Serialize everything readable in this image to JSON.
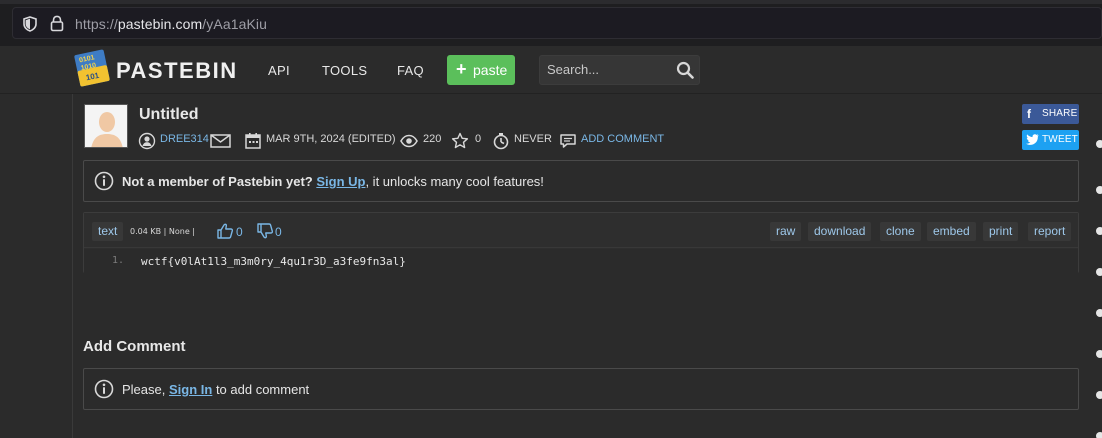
{
  "browser": {
    "url_scheme": "https://",
    "url_host": "pastebin.com",
    "url_path": "/yAa1aKiu"
  },
  "header": {
    "brand": "PASTEBIN",
    "logo_digits": [
      "0101",
      "1010",
      "101"
    ],
    "nav": [
      "API",
      "TOOLS",
      "FAQ"
    ],
    "paste_button": "paste",
    "search_placeholder": "Search..."
  },
  "post": {
    "title": "Untitled",
    "author": "DREE314",
    "date": "MAR 9TH, 2024 (EDITED)",
    "views": "220",
    "stars": "0",
    "expiry": "NEVER",
    "add_comment_link": "ADD COMMENT",
    "share_label": "SHARE",
    "tweet_label": "TWEET"
  },
  "notice": {
    "bold_text": "Not a member of Pastebin yet?",
    "link": "Sign Up",
    "rest": ", it unlocks many cool features!"
  },
  "code": {
    "syntax": "text",
    "info": "0.04 KB | None |",
    "likes": "0",
    "dislikes": "0",
    "actions": [
      "raw",
      "download",
      "clone",
      "embed",
      "print",
      "report"
    ],
    "lines": [
      {
        "num": "1.",
        "text": "wctf{v0lAt1l3_m3m0ry_4qu1r3D_a3fe9fn3al}"
      }
    ]
  },
  "comments": {
    "heading": "Add Comment",
    "prompt_before": "Please, ",
    "link": "Sign In",
    "prompt_after": " to add comment"
  },
  "colors": {
    "accent_green": "#5bbf5b",
    "link_blue": "#7ab7e6",
    "facebook": "#3b5998",
    "twitter": "#1da1f2"
  }
}
